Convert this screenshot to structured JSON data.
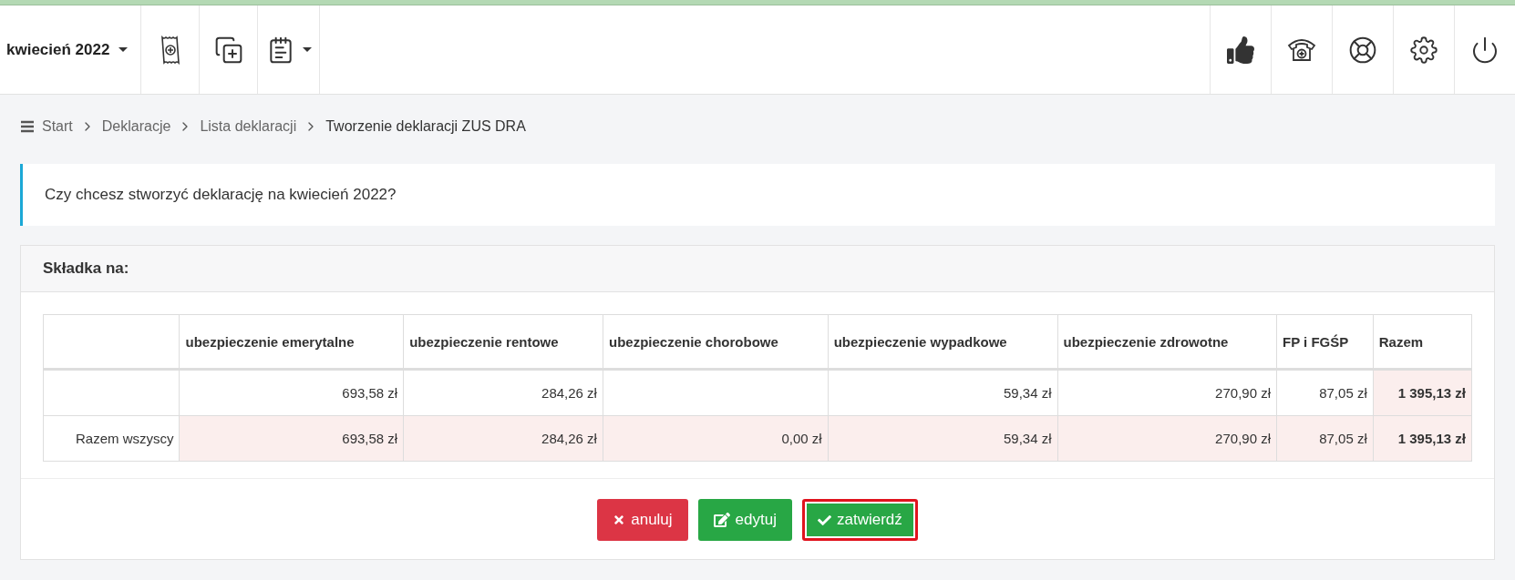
{
  "top_bar": {
    "period": "kwiecień 2022",
    "left_tools": [
      {
        "kind": "receipt",
        "menu": false
      },
      {
        "kind": "copy",
        "menu": false
      },
      {
        "kind": "notepad",
        "menu": true
      }
    ],
    "right_tools": [
      {
        "kind": "thumb"
      },
      {
        "kind": "phone"
      },
      {
        "kind": "lifebuoy"
      },
      {
        "kind": "settings"
      },
      {
        "kind": "power"
      }
    ]
  },
  "breadcrumb": [
    "Start",
    "Deklaracje",
    "Lista deklaracji",
    "Tworzenie deklaracji ZUS DRA"
  ],
  "alert": "Czy chcesz stworzyć deklarację na kwiecień 2022?",
  "panel": {
    "title": "Składka na:",
    "table": {
      "columns": [
        {
          "kind": "label"
        },
        {
          "label": "ubezpieczenie emerytalne",
          "kind": "value"
        },
        {
          "label": "ubezpieczenie rentowe",
          "kind": "value"
        },
        {
          "label": "ubezpieczenie chorobowe",
          "kind": "value"
        },
        {
          "label": "ubezpieczenie wypadkowe",
          "kind": "value"
        },
        {
          "label": "ubezpieczenie zdrowotne",
          "kind": "value"
        },
        {
          "label": "FP i FGŚP",
          "kind": "value"
        },
        {
          "label": "Razem",
          "kind": "sum"
        }
      ],
      "rows": [
        {
          "kind": "item",
          "cells": [
            null,
            "693,58 zł",
            "284,26 zł",
            null,
            "59,34 zł",
            "270,90 zł",
            "87,05 zł",
            "1 395,13 zł"
          ]
        },
        {
          "kind": "total",
          "cells": [
            "Razem wszyscy",
            "693,58 zł",
            "284,26 zł",
            "0,00 zł",
            "59,34 zł",
            "270,90 zł",
            "87,05 zł",
            "1 395,13 zł"
          ]
        }
      ]
    },
    "buttons": [
      {
        "kind": "cancel",
        "label": "anuluj",
        "highlighted": false
      },
      {
        "kind": "edit",
        "label": "edytuj",
        "highlighted": false
      },
      {
        "kind": "confirm",
        "label": "zatwierdź",
        "highlighted": true
      }
    ]
  }
}
